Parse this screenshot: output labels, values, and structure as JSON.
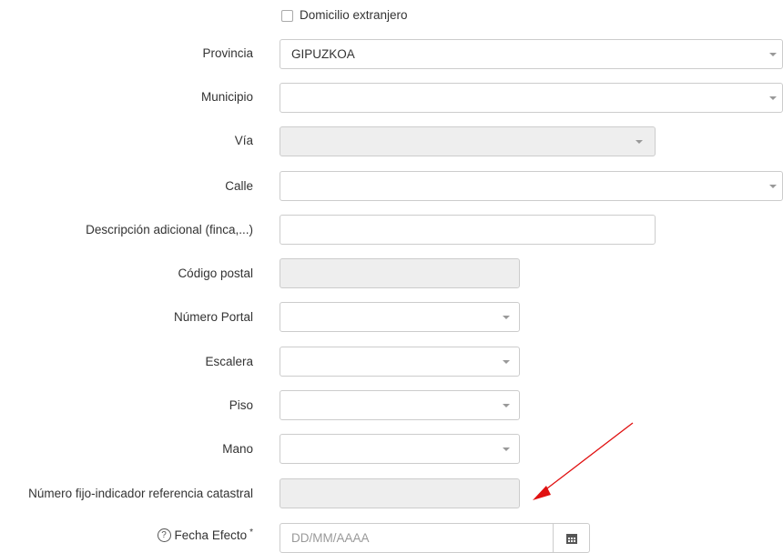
{
  "checkbox": {
    "label": "Domicilio extranjero",
    "checked": false
  },
  "fields": {
    "provincia": {
      "label": "Provincia",
      "value": "GIPUZKOA"
    },
    "municipio": {
      "label": "Municipio",
      "value": ""
    },
    "via": {
      "label": "Vía",
      "value": ""
    },
    "calle": {
      "label": "Calle",
      "value": ""
    },
    "descripcion": {
      "label": "Descripción adicional (finca,...)",
      "value": ""
    },
    "codigo_postal": {
      "label": "Código postal",
      "value": ""
    },
    "numero_portal": {
      "label": "Número Portal",
      "value": ""
    },
    "escalera": {
      "label": "Escalera",
      "value": ""
    },
    "piso": {
      "label": "Piso",
      "value": ""
    },
    "mano": {
      "label": "Mano",
      "value": ""
    },
    "referencia_catastral": {
      "label": "Número fijo-indicador referencia catastral",
      "value": ""
    },
    "fecha_efecto": {
      "label": "Fecha Efecto",
      "required_mark": "*",
      "placeholder": "DD/MM/AAAA",
      "help_icon": "question-circle-icon",
      "calendar_icon": "calendar-icon"
    }
  },
  "annotation": {
    "arrow_color": "#e01010"
  }
}
